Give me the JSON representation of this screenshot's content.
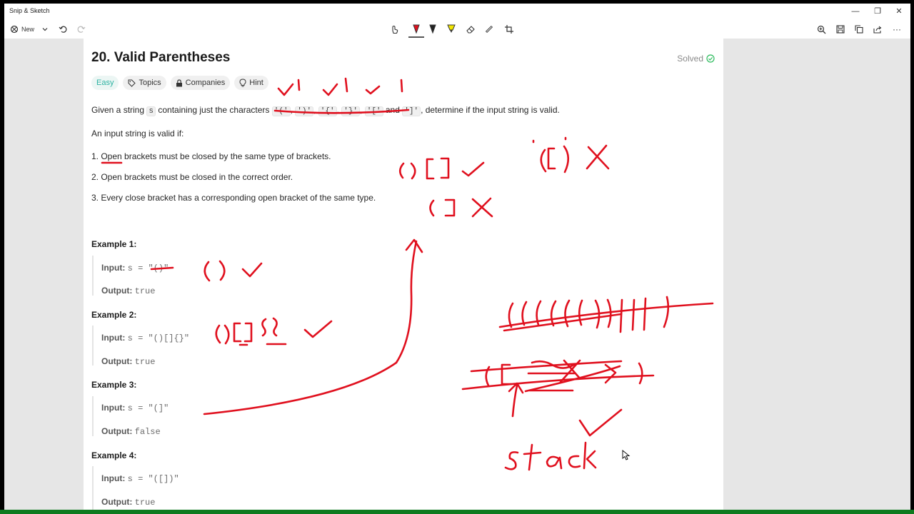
{
  "app": {
    "title": "Snip & Sketch",
    "new_label": "New"
  },
  "window_controls": {
    "minimize": "—",
    "restore": "❐",
    "close": "✕"
  },
  "toolbar": {
    "left_icons": [
      "new-snip-icon",
      "chevron-down-icon",
      "undo-icon",
      "redo-icon"
    ],
    "center_tools": [
      "touch-writing-icon",
      "ballpoint-pen-icon",
      "pencil-icon",
      "highlighter-icon",
      "eraser-icon",
      "ruler-icon",
      "crop-icon"
    ],
    "right_tools": [
      "zoom-icon",
      "save-icon",
      "copy-icon",
      "share-icon",
      "more-icon"
    ],
    "more_label": "···"
  },
  "problem": {
    "title": "20. Valid Parentheses",
    "status": "Solved",
    "tags": {
      "difficulty": "Easy",
      "topics": "Topics",
      "companies": "Companies",
      "hint": "Hint"
    },
    "statement": {
      "prefix": "Given a string",
      "var": "s",
      "middle": "containing just the characters",
      "chars": [
        "'('",
        "')'",
        "'{'",
        "'}'",
        "'['"
      ],
      "and": "and",
      "last_char": "']'",
      "suffix": ", determine if the input string is valid."
    },
    "valid_if": "An input string is valid if:",
    "rules": [
      "1. Open brackets must be closed by the same type of brackets.",
      "2. Open brackets must be closed in the correct order.",
      "3. Every close bracket has a corresponding open bracket of the same type."
    ],
    "examples": [
      {
        "title": "Example 1:",
        "input_label": "Input:",
        "input": "s = \"()\"",
        "output_label": "Output:",
        "output": "true"
      },
      {
        "title": "Example 2:",
        "input_label": "Input:",
        "input": "s = \"()[]{}\"",
        "output_label": "Output:",
        "output": "true"
      },
      {
        "title": "Example 3:",
        "input_label": "Input:",
        "input": "s = \"(]\"",
        "output_label": "Output:",
        "output": "false"
      },
      {
        "title": "Example 4:",
        "input_label": "Input:",
        "input": "s = \"([])\"",
        "output_label": "Output:",
        "output": "true"
      }
    ]
  },
  "annotations": {
    "ink_color": "#e0101e",
    "handwritten_text": [
      "stack"
    ]
  },
  "colors": {
    "accent_easy": "#2fb3a3",
    "solved_check": "#2cbb5d",
    "ink": "#e0101e",
    "bottom_strip": "#0e7a1f"
  }
}
